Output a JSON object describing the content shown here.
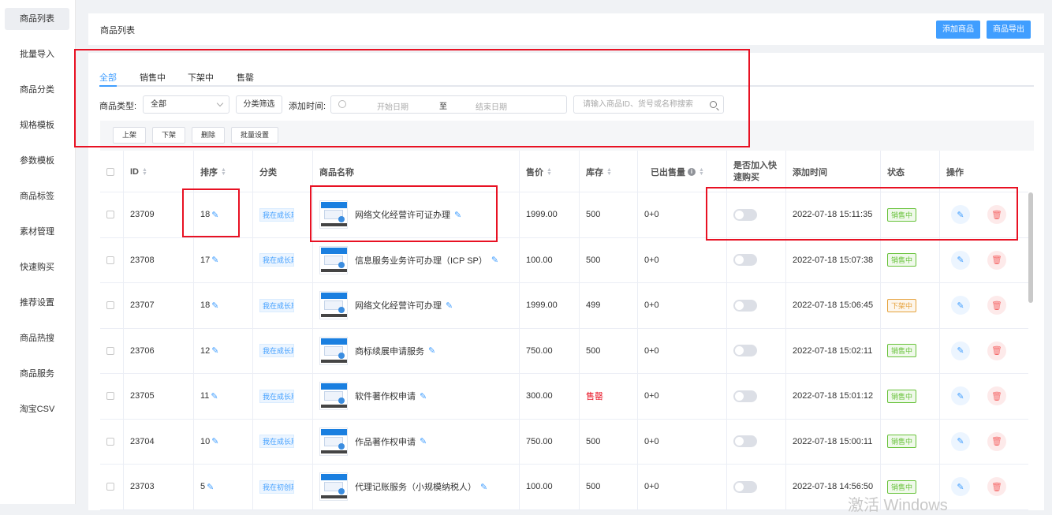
{
  "sidebar": {
    "items": [
      {
        "label": "商品列表",
        "active": true
      },
      {
        "label": "批量导入"
      },
      {
        "label": "商品分类"
      },
      {
        "label": "规格模板"
      },
      {
        "label": "参数模板"
      },
      {
        "label": "商品标签"
      },
      {
        "label": "素材管理"
      },
      {
        "label": "快速购买"
      },
      {
        "label": "推荐设置"
      },
      {
        "label": "商品热搜"
      },
      {
        "label": "商品服务"
      },
      {
        "label": "淘宝CSV"
      }
    ]
  },
  "header": {
    "title": "商品列表",
    "add_button": "添加商品",
    "export_button": "商品导出"
  },
  "tabs": [
    {
      "label": "全部",
      "active": true
    },
    {
      "label": "销售中"
    },
    {
      "label": "下架中"
    },
    {
      "label": "售罄"
    }
  ],
  "filters": {
    "type_label": "商品类型:",
    "type_value": "全部",
    "category_button": "分类筛选",
    "time_label": "添加时间:",
    "start_placeholder": "开始日期",
    "range_separator": "至",
    "end_placeholder": "结束日期",
    "search_placeholder": "请输入商品ID、货号或名称搜索"
  },
  "batch": {
    "shelve": "上架",
    "unshelve": "下架",
    "delete": "删除",
    "settings": "批量设置"
  },
  "columns": {
    "id": "ID",
    "sort": "排序",
    "category": "分类",
    "name": "商品名称",
    "price": "售价",
    "stock": "库存",
    "sold": "已出售量",
    "quick_buy_line1": "是否加入快",
    "quick_buy_line2": "速购买",
    "added_time": "添加时间",
    "status": "状态",
    "actions": "操作"
  },
  "rows": [
    {
      "id": "23709",
      "sort": "18",
      "category": "我在成长期",
      "name": "网络文化经营许可证办理",
      "price": "1999.00",
      "stock": "500",
      "sold": "0+0",
      "added": "2022-07-18 15:11:35",
      "status": "销售中"
    },
    {
      "id": "23708",
      "sort": "17",
      "category": "我在成长期",
      "name": "信息服务业务许可办理（ICP SP）",
      "price": "100.00",
      "stock": "500",
      "sold": "0+0",
      "added": "2022-07-18 15:07:38",
      "status": "销售中"
    },
    {
      "id": "23707",
      "sort": "18",
      "category": "我在成长期",
      "name": "网络文化经营许可办理",
      "price": "1999.00",
      "stock": "499",
      "sold": "0+0",
      "added": "2022-07-18 15:06:45",
      "status": "下架中"
    },
    {
      "id": "23706",
      "sort": "12",
      "category": "我在成长期",
      "name": "商标续展申请服务",
      "price": "750.00",
      "stock": "500",
      "sold": "0+0",
      "added": "2022-07-18 15:02:11",
      "status": "销售中"
    },
    {
      "id": "23705",
      "sort": "11",
      "category": "我在成长期",
      "name": "软件著作权申请",
      "price": "300.00",
      "stock": "售罄",
      "sold": "0+0",
      "added": "2022-07-18 15:01:12",
      "status": "销售中"
    },
    {
      "id": "23704",
      "sort": "10",
      "category": "我在成长期",
      "name": "作品著作权申请",
      "price": "750.00",
      "stock": "500",
      "sold": "0+0",
      "added": "2022-07-18 15:00:11",
      "status": "销售中"
    },
    {
      "id": "23703",
      "sort": "5",
      "category": "我在初创期",
      "name": "代理记账服务（小规模纳税人）",
      "price": "100.00",
      "stock": "500",
      "sold": "0+0",
      "added": "2022-07-18 14:56:50",
      "status": "销售中"
    }
  ],
  "colors": {
    "accent": "#409eff",
    "sale_badge": "#67c23a",
    "off_badge": "#e6a23c",
    "annotation_box": "#e81123",
    "sold_out_text": "#e81123"
  },
  "watermark": "激活 Windows"
}
